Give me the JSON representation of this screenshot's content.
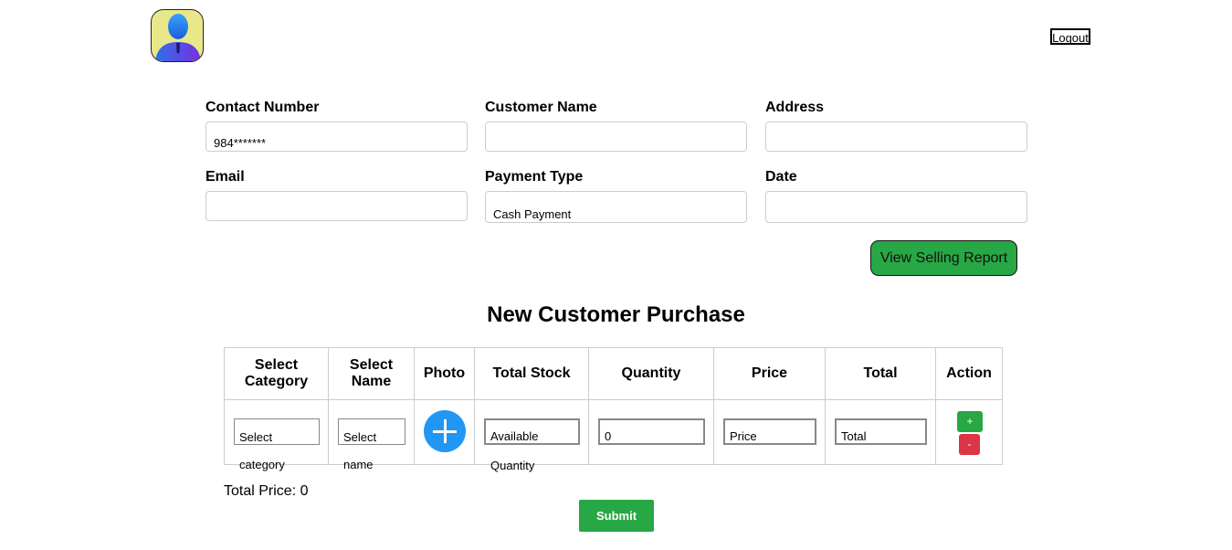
{
  "header": {
    "avatar_icon": "user-avatar-icon",
    "logout_label": "Logout"
  },
  "form": {
    "contact_number": {
      "label": "Contact Number",
      "value": "984*******"
    },
    "customer_name": {
      "label": "Customer Name",
      "value": ""
    },
    "address": {
      "label": "Address",
      "value": ""
    },
    "email": {
      "label": "Email",
      "value": ""
    },
    "payment_type": {
      "label": "Payment Type",
      "value": "Cash Payment"
    },
    "date": {
      "label": "Date",
      "value": ""
    }
  },
  "report_button": "View Selling Report",
  "section_title": "New Customer Purchase",
  "table": {
    "headers": {
      "category_line1": "Select",
      "category_line2": "Category",
      "name_line1": "Select",
      "name_line2": "Name",
      "photo": "Photo",
      "total_stock": "Total Stock",
      "quantity": "Quantity",
      "price": "Price",
      "total": "Total",
      "action": "Action"
    },
    "row": {
      "category_placeholder_1": "Select",
      "category_placeholder_2": "category",
      "name_placeholder_1": "Select",
      "name_placeholder_2": "name",
      "photo_icon": "add-photo-icon",
      "stock_placeholder_1": "Available",
      "stock_placeholder_2": "Quantity",
      "quantity_value": "0",
      "price_placeholder": "Price",
      "total_placeholder": "Total",
      "add_label": "+",
      "remove_label": "-"
    }
  },
  "total_price": "Total Price: 0",
  "submit_label": "Submit",
  "colors": {
    "green": "#28a745",
    "red": "#dc3545",
    "blue": "#2196f3",
    "avatar_bg": "#e8e88a"
  }
}
